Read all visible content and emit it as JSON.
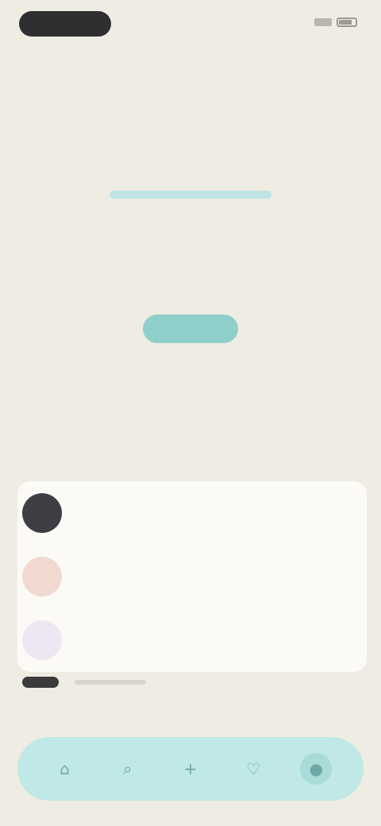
{
  "statusbar": {
    "time": "",
    "icons": [
      "signal-icon",
      "battery-icon"
    ]
  },
  "hero": {
    "title": "",
    "subtitle": "",
    "cta_label": "",
    "price": "",
    "price_sub": ""
  },
  "section": {
    "heading": ""
  },
  "list": [
    {
      "title": "",
      "desc": "",
      "avatar_color": "#3e3f44"
    },
    {
      "title": "",
      "desc": "",
      "avatar_color": "#f2d9cf"
    },
    {
      "title": "",
      "desc": "",
      "avatar_color": "#ece7f3"
    }
  ],
  "footer": {
    "note": ""
  },
  "tabbar": {
    "tabs": [
      {
        "icon": "home-icon"
      },
      {
        "icon": "search-icon"
      },
      {
        "icon": "add-icon"
      },
      {
        "icon": "heart-icon"
      },
      {
        "icon": "profile-icon"
      }
    ]
  },
  "colors": {
    "background": "#efece3",
    "accent": "#8fcfca",
    "tabbar": "#bfe8e6"
  }
}
